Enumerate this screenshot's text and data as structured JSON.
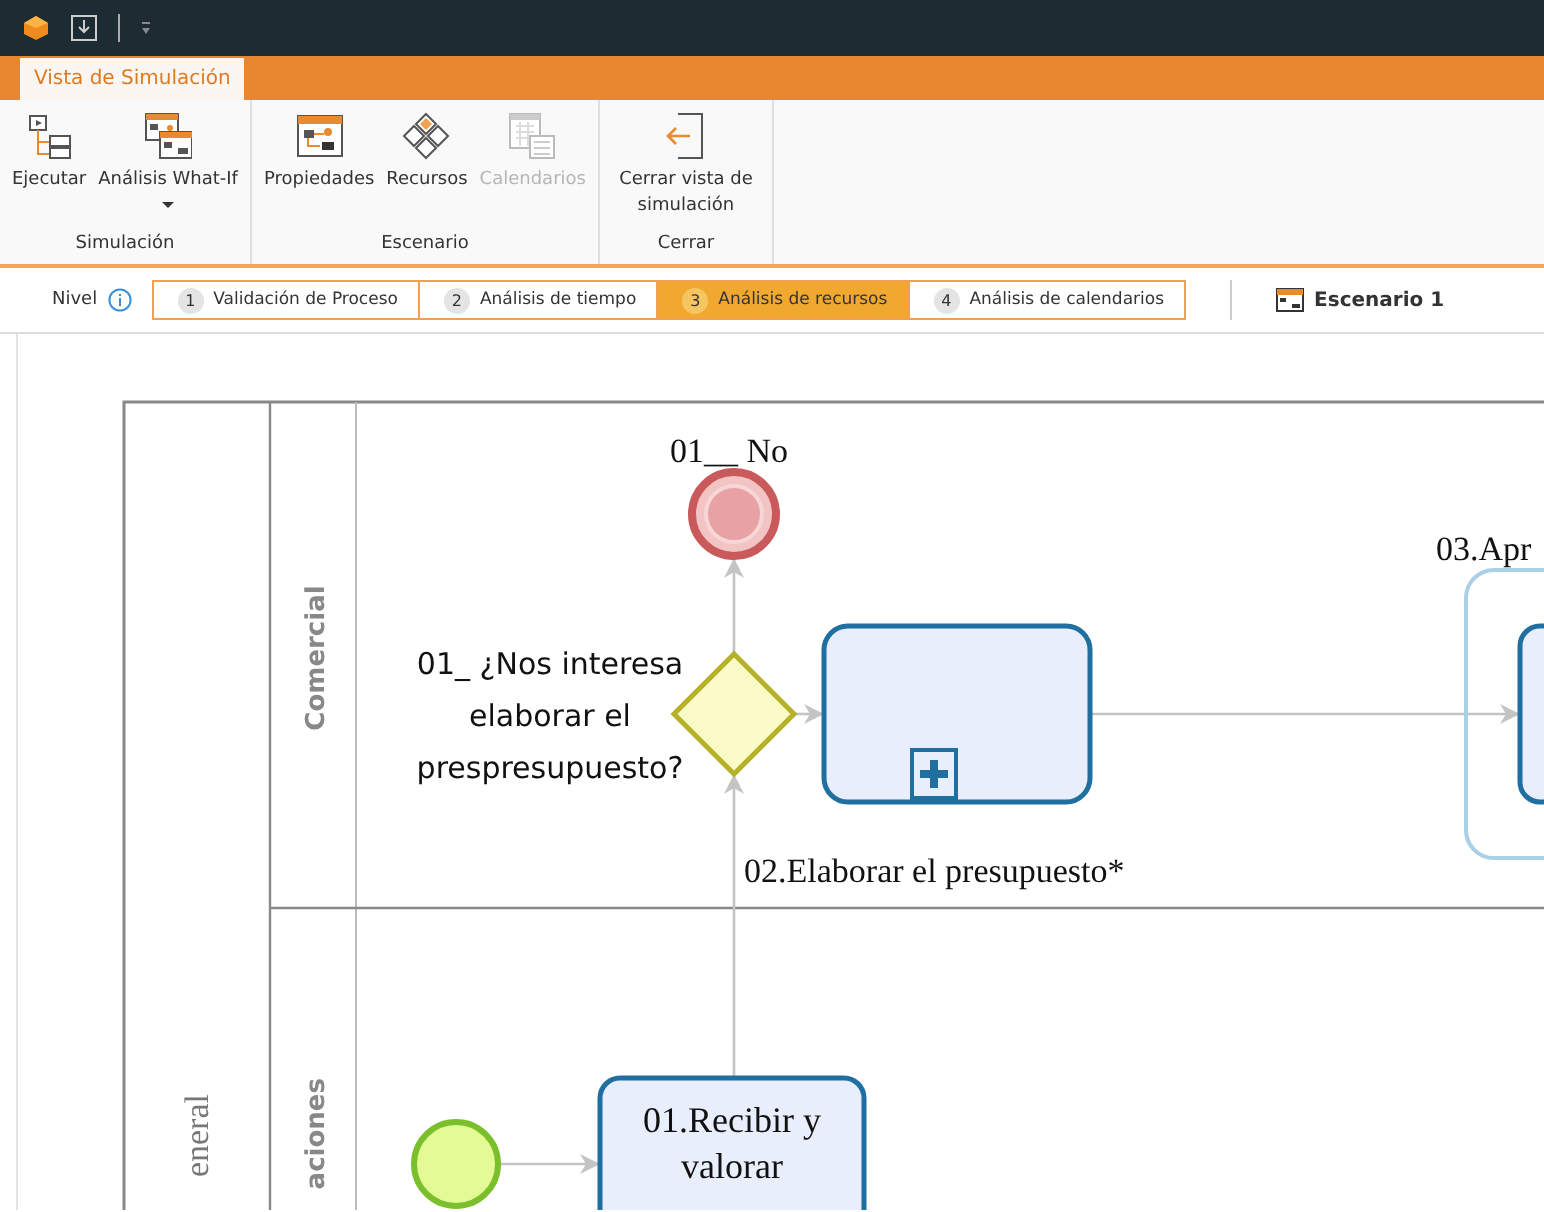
{
  "ribbon": {
    "tabs": [
      {
        "label": "Vista de Simulación",
        "selected": true
      }
    ],
    "groups": [
      {
        "label": "Simulación",
        "buttons": [
          {
            "label": "Ejecutar",
            "disabled": false,
            "dropdown": false
          },
          {
            "label": "Análisis What-If",
            "disabled": false,
            "dropdown": true
          }
        ]
      },
      {
        "label": "Escenario",
        "buttons": [
          {
            "label": "Propiedades",
            "disabled": false,
            "dropdown": false
          },
          {
            "label": "Recursos",
            "disabled": false,
            "dropdown": false
          },
          {
            "label": "Calendarios",
            "disabled": true,
            "dropdown": false
          }
        ]
      },
      {
        "label": "Cerrar",
        "buttons": [
          {
            "label": "Cerrar vista de simulación",
            "disabled": false,
            "dropdown": false
          }
        ]
      }
    ]
  },
  "level_bar": {
    "label": "Nivel",
    "steps": [
      {
        "number": "1",
        "label": "Validación de Proceso",
        "selected": false
      },
      {
        "number": "2",
        "label": "Análisis de tiempo",
        "selected": false
      },
      {
        "number": "3",
        "label": "Análisis de recursos",
        "selected": true
      },
      {
        "number": "4",
        "label": "Análisis de calendarios",
        "selected": false
      }
    ],
    "scenario": {
      "label": "Escenario 1"
    }
  },
  "diagram": {
    "pool": {
      "label": "eneral"
    },
    "lanes": [
      {
        "label": "Comercial"
      },
      {
        "label": "aciones"
      }
    ],
    "nodes": [
      {
        "kind": "end_event",
        "lines": [
          "01__ No"
        ]
      },
      {
        "kind": "gateway",
        "lines": [
          "01_ ¿Nos interesa",
          "elaborar el",
          "prespresupuesto?"
        ]
      },
      {
        "kind": "subprocess",
        "lines": [
          "02.Elaborar el presupuesto*"
        ]
      },
      {
        "kind": "group",
        "lines": [
          "03.Apr"
        ]
      },
      {
        "kind": "start_event"
      },
      {
        "kind": "task",
        "lines": [
          "01.Recibir y",
          "valorar"
        ]
      }
    ]
  }
}
